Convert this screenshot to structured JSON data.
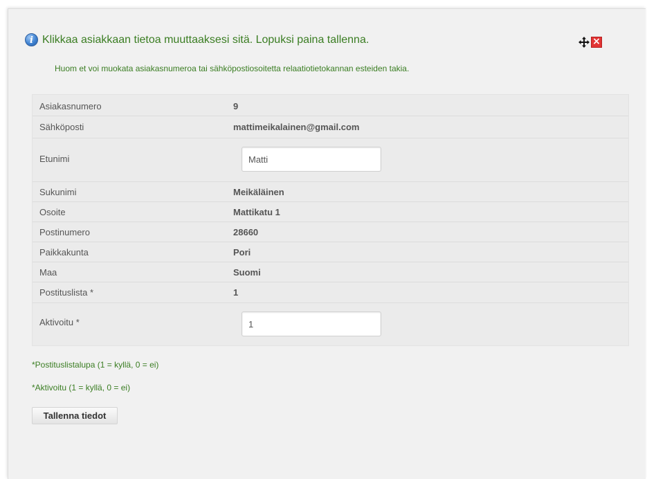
{
  "dialog": {
    "title": "Klikkaa asiakkaan tietoa muuttaaksesi sitä. Lopuksi paina tallenna.",
    "info_icon": "info-icon",
    "note": "Huom et voi muokata asiakasnumeroa tai sähköpostiosoitetta relaatiotietokannan esteiden takia.",
    "move_icon": "move-icon",
    "close_icon": "close-icon",
    "colors": {
      "title": "#3a7d22",
      "close": "#e23434"
    }
  },
  "fields": {
    "asiakasnumero": {
      "label": "Asiakasnumero",
      "value": "9"
    },
    "sahkoposti": {
      "label": "Sähköposti",
      "value": "mattimeikalainen@gmail.com"
    },
    "etunimi": {
      "label": "Etunimi",
      "value": "Matti"
    },
    "sukunimi": {
      "label": "Sukunimi",
      "value": "Meikäläinen"
    },
    "osoite": {
      "label": "Osoite",
      "value": "Mattikatu 1"
    },
    "postinumero": {
      "label": "Postinumero",
      "value": "28660"
    },
    "paikkakunta": {
      "label": "Paikkakunta",
      "value": "Pori"
    },
    "maa": {
      "label": "Maa",
      "value": "Suomi"
    },
    "postituslista": {
      "label": "Postituslista *",
      "value": "1"
    },
    "aktivoitu": {
      "label": "Aktivoitu *",
      "value": "1"
    }
  },
  "footnotes": {
    "postituslista": "*Postituslistalupa (1 = kyllä, 0 = ei)",
    "aktivoitu": "*Aktivoitu (1 = kyllä, 0 = ei)"
  },
  "save_button": "Tallenna tiedot"
}
